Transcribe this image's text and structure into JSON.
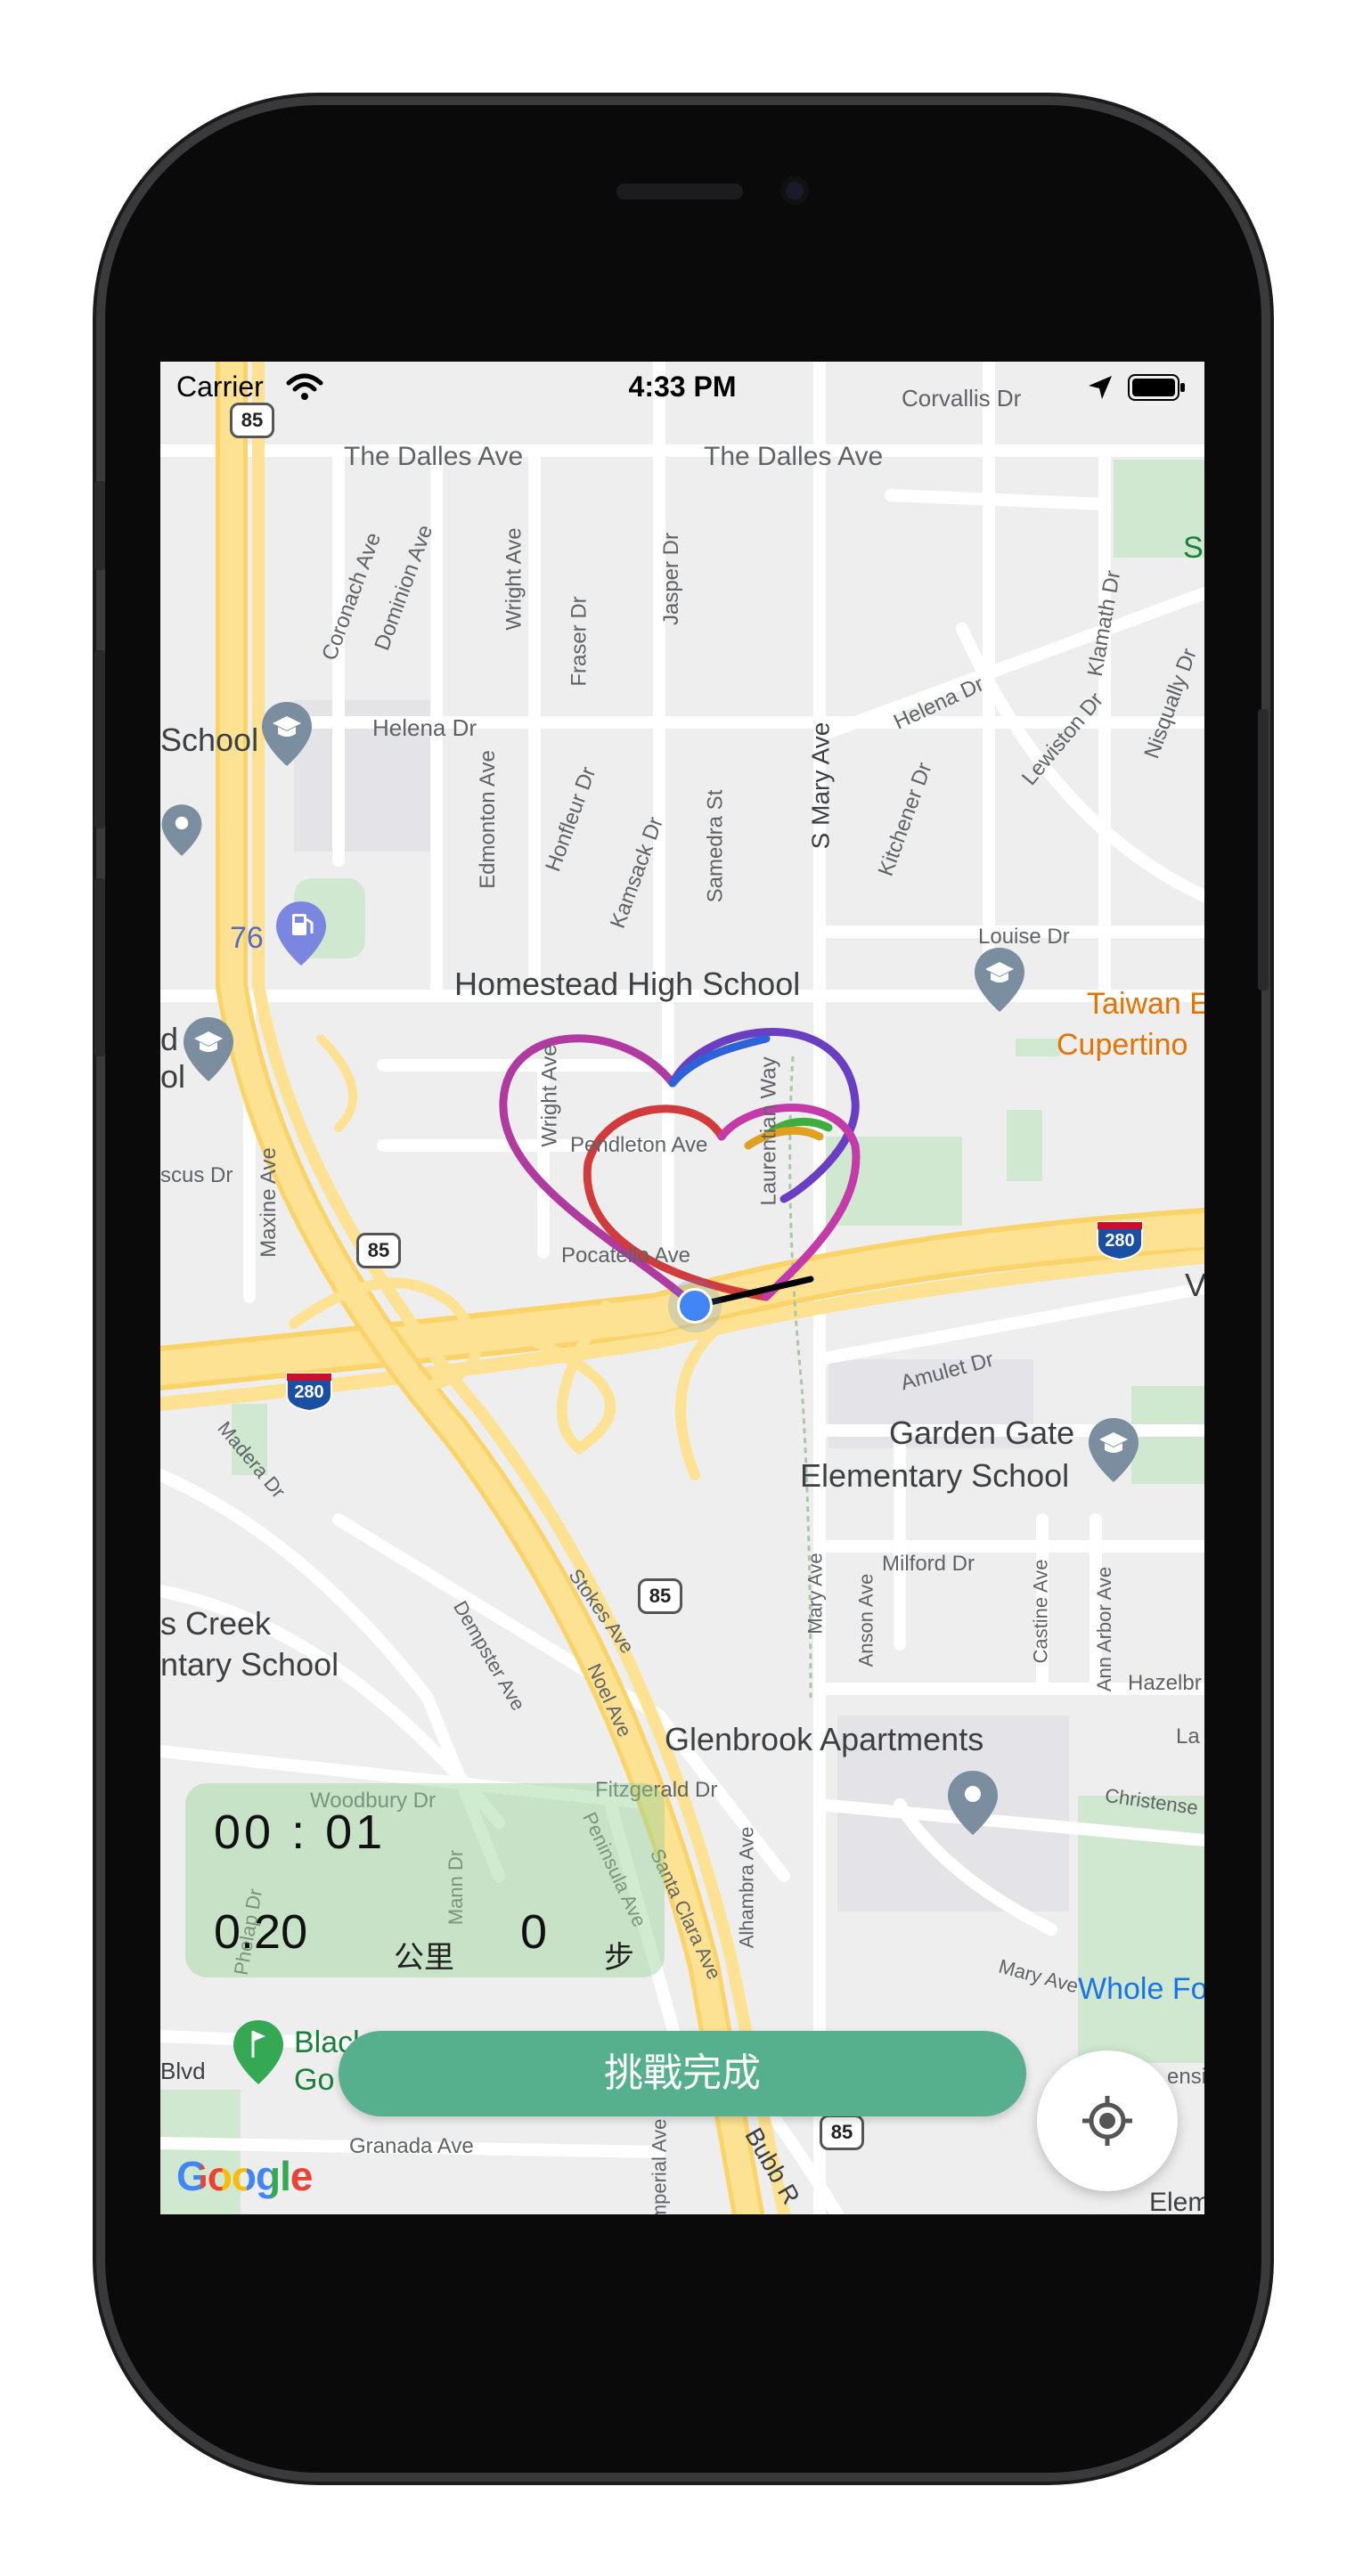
{
  "status_bar": {
    "carrier": "Carrier",
    "time": "4:33 PM"
  },
  "map": {
    "streets": {
      "corvallis": "Corvallis Dr",
      "dalles_left": "The Dalles Ave",
      "dalles_right": "The Dalles Ave",
      "coronach": "Coronach Ave",
      "dominion": "Dominion Ave",
      "wright_top": "Wright Ave",
      "fraser": "Fraser Dr",
      "jasper": "Jasper Dr",
      "klamath": "Klamath Dr",
      "nisqually": "Nisqually Dr",
      "helena_left": "Helena Dr",
      "helena_right": "Helena Dr",
      "lewiston": "Lewiston Dr",
      "honfleur": "Honfleur Dr",
      "edmonton": "Edmonton Ave",
      "kamsack": "Kamsack Dr",
      "samedra": "Samedra St",
      "s_mary": "S Mary Ave",
      "kitchener": "Kitchener Dr",
      "louise": "Louise Dr",
      "wright_mid": "Wright Ave",
      "pendleton": "Pendleton Ave",
      "laurentian": "Laurentian Way",
      "pocatello": "Pocatello Ave",
      "escus": "scus Dr",
      "maxine": "Maxine Ave",
      "madera": "Madera Dr",
      "amulet": "Amulet Dr",
      "milford": "Milford Dr",
      "mary_ave": "Mary Ave",
      "anson": "Anson Ave",
      "castine": "Castine Ave",
      "ann_arbor": "Ann Arbor Ave",
      "hazelbr": "Hazelbr",
      "la": "La",
      "dempster": "Dempster Ave",
      "stokes": "Stokes Ave",
      "noel": "Noel Ave",
      "woodbury": "Woodbury Dr",
      "fitzgerald": "Fitzgerald Dr",
      "peninsula": "Peninsula Ave",
      "santa_clara": "Santa Clara Ave",
      "alhambra": "Alhambra Ave",
      "christense": "Christense",
      "mary_ave_2": "Mary Ave",
      "mann": "Mann Dr",
      "phelap": "Phelap Dr",
      "blvd": "Blvd",
      "granada": "Granada Ave",
      "imperial": "Imperial Ave",
      "bubb": "Bubb R",
      "ensi": "ensi"
    },
    "places": {
      "school_left": "School",
      "homestead": "Homestead High School",
      "taiwan": "Taiwan E",
      "cupertino": "Cupertino",
      "d_label": "d",
      "ol_label": "ol",
      "garden_gate_1": "Garden Gate",
      "garden_gate_2": "Elementary School",
      "creek_1": "s Creek",
      "creek_2": "ntary School",
      "glenbrook": "Glenbrook Apartments",
      "whole_foods": "Whole Fo",
      "black_1": "Black",
      "black_2": "Go",
      "elem": "Elem",
      "s_right": "S",
      "v_right": "V"
    },
    "highway_shields": {
      "sh85_top": "85",
      "sh85_mid": "85",
      "sh85_lower": "85",
      "sh85_bottom": "85",
      "i280_left": "280",
      "i280_right": "280"
    },
    "gas_station_label": "76",
    "attribution": "Google"
  },
  "stats": {
    "elapsed": "00 : 01",
    "distance": "0.20",
    "distance_unit": "公里",
    "steps": "0",
    "steps_unit": "步"
  },
  "finish_button": {
    "label": "挑戰完成"
  },
  "icons": {
    "wifi": "wifi-icon",
    "location_arrow": "location-arrow-icon",
    "battery": "battery-icon",
    "school_pin": "school-pin-icon",
    "place_pin": "place-pin-icon",
    "gas_pin": "gas-station-pin-icon",
    "golf_pin": "golf-pin-icon",
    "user_location": "user-location-dot",
    "locate": "my-location-icon"
  },
  "colors": {
    "finish_button": "#56b08e",
    "user_dot": "#4285f4",
    "freeway": "#fde293",
    "stats_panel": "#96d296"
  }
}
